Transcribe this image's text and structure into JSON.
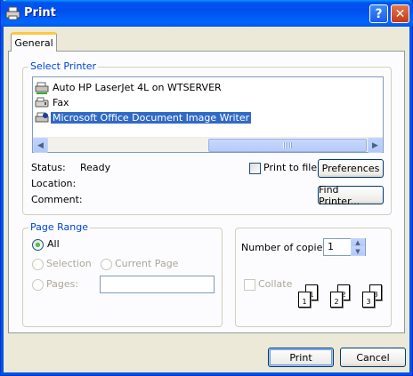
{
  "window": {
    "title": "Print"
  },
  "titlebar": {
    "help_label": "?",
    "close_label": "✕"
  },
  "tabs": [
    {
      "label": "General"
    }
  ],
  "select_printer": {
    "legend": "Select Printer",
    "printers": [
      {
        "name": "Auto HP LaserJet 4L on WTSERVER",
        "icon": "network-printer-icon"
      },
      {
        "name": "Fax",
        "icon": "fax-icon"
      },
      {
        "name": "Microsoft Office Document Image Writer",
        "icon": "default-printer-icon",
        "selected": true
      }
    ],
    "status_label": "Status:",
    "status_value": "Ready",
    "location_label": "Location:",
    "location_value": "",
    "comment_label": "Comment:",
    "comment_value": "",
    "print_to_file_label": "Print to file",
    "print_to_file_checked": false,
    "preferences_label": "Preferences",
    "find_printer_label": "Find Printer..."
  },
  "page_range": {
    "legend": "Page Range",
    "all_label": "All",
    "selection_label": "Selection",
    "current_page_label": "Current Page",
    "pages_label": "Pages:",
    "pages_value": "",
    "selected_option": "All"
  },
  "copies": {
    "label": "Number of copies:",
    "value": "1",
    "collate_label": "Collate",
    "collate_checked": false,
    "page_numbers": [
      "1",
      "1",
      "2",
      "2",
      "3",
      "3"
    ]
  },
  "buttons": {
    "print_label": "Print",
    "cancel_label": "Cancel"
  },
  "colors": {
    "title_bar": "#0054e3",
    "selection": "#316ac5",
    "group_label": "#0046d5",
    "dialog_bg": "#ece9d8"
  }
}
